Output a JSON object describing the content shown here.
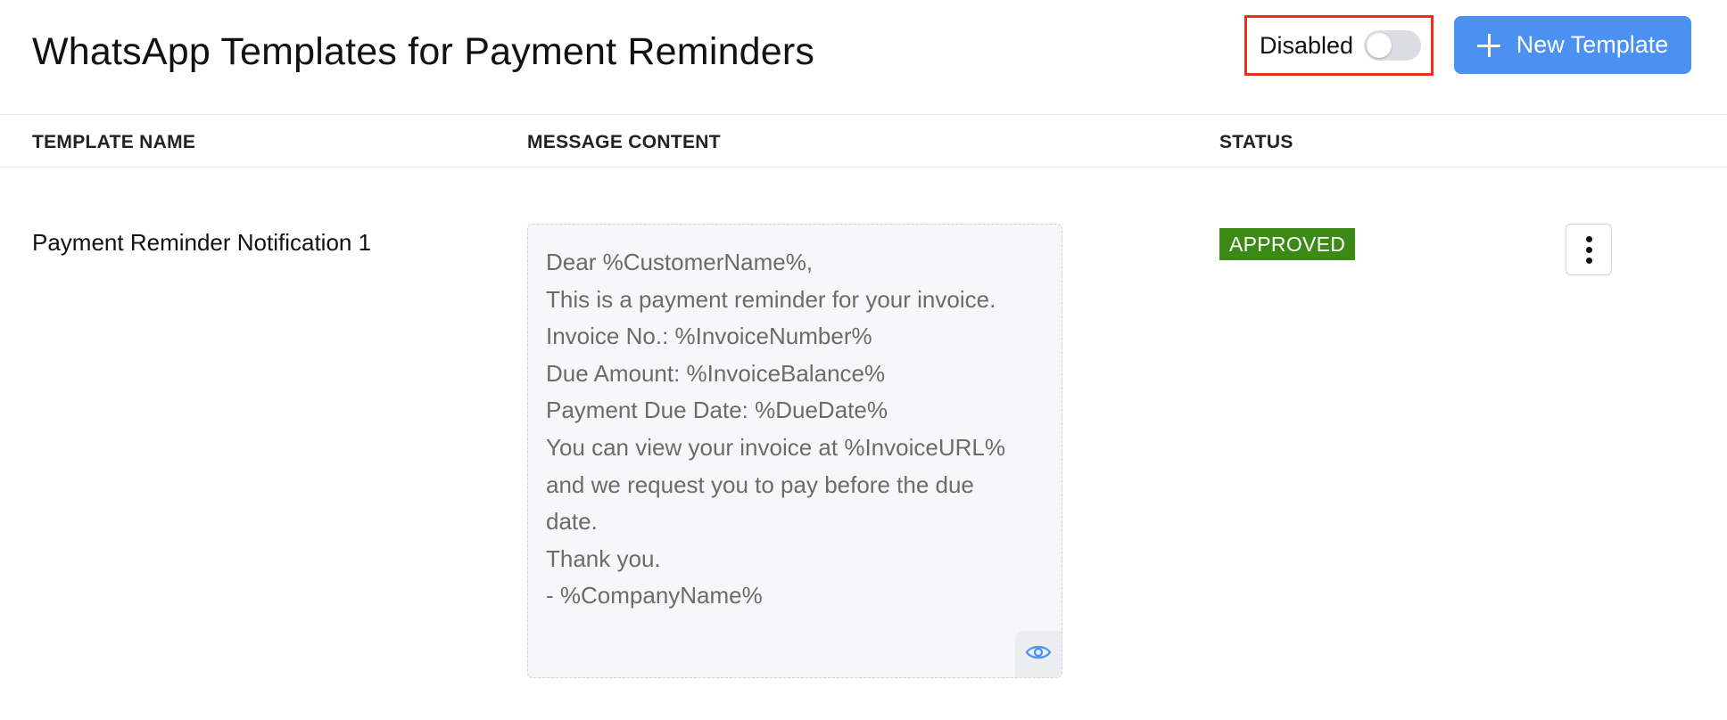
{
  "header": {
    "title": "WhatsApp Templates for Payment Reminders",
    "toggle": {
      "label": "Disabled",
      "enabled": false
    },
    "new_button_label": "New Template",
    "new_button_icon": "plus-icon",
    "accent_color": "#4b91f1",
    "highlight_color": "#e8311a"
  },
  "table": {
    "columns": [
      "TEMPLATE NAME",
      "MESSAGE CONTENT",
      "STATUS"
    ],
    "rows": [
      {
        "name": "Payment Reminder Notification 1",
        "message_lines": [
          "Dear %CustomerName%,",
          "This is a payment reminder for your invoice.",
          "Invoice No.: %InvoiceNumber%",
          "Due Amount: %InvoiceBalance%",
          "Payment Due Date: %DueDate%",
          "You can view your invoice at %InvoiceURL%",
          "and we request you to pay before the due",
          "date.",
          "Thank you.",
          "- %CompanyName%"
        ],
        "preview_icon": "eye-icon",
        "status": "APPROVED",
        "status_color": "#3a8a15",
        "actions_icon": "more-vertical-icon"
      }
    ]
  }
}
